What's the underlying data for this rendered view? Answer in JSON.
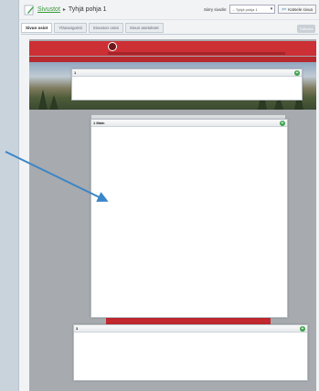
{
  "breadcrumb": {
    "link": "Sivustot",
    "separator": "▸",
    "current": "Tyhjä pohja 1"
  },
  "toolbar": {
    "goto_label": "Siirry sivulle:",
    "goto_select_value": "-- Tyhjä pohja 1",
    "back_label": "Katsele sivua",
    "save_label": "Tallenna"
  },
  "tabs": [
    {
      "label": "Sivun osiot"
    },
    {
      "label": "Ylänavigointi"
    },
    {
      "label": "Sivuston osiot"
    },
    {
      "label": "Sivun asetukset"
    }
  ],
  "blocks": [
    {
      "name": "1"
    },
    {
      "name": "1 Main"
    },
    {
      "name": "3"
    }
  ],
  "colors": {
    "brand_red": "#cc2f34",
    "add_green": "#3fa34d",
    "arrow_blue": "#3a86c8"
  },
  "icons": {
    "edit": "pencil-icon",
    "add": "plus-icon",
    "back": "arrow-left-icon"
  }
}
